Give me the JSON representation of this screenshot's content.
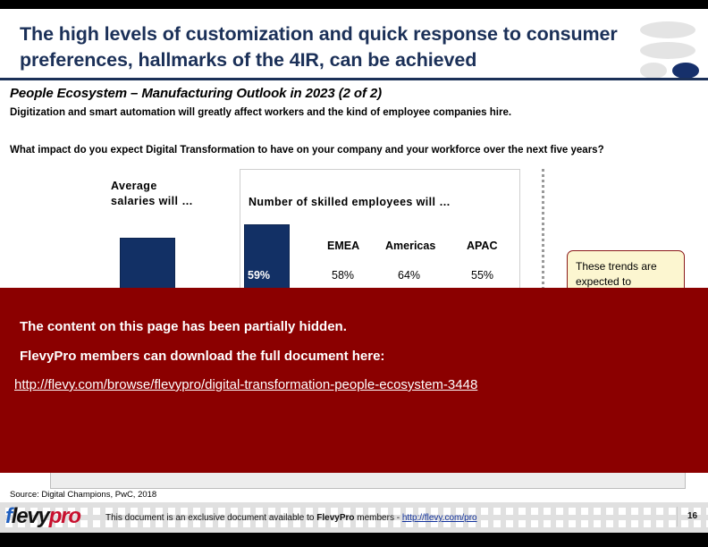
{
  "header": {
    "title": "The high levels of customization and quick response to consumer preferences, hallmarks of the 4IR, can be achieved",
    "accent_color": "#1b3058",
    "decor_dot_color": "#16306b"
  },
  "section": {
    "title": "People Ecosystem – Manufacturing Outlook in 2023 (2 of 2)",
    "description": "Digitization and smart automation will greatly affect workers and the kind of employee companies hire.",
    "question": "What impact do you expect Digital Transformation to have on your company and your workforce over the next five years?"
  },
  "chart_data": {
    "type": "bar",
    "title": "What impact do you expect Digital Transformation to have on your company and your workforce over the next five years?",
    "groups": [
      {
        "label": "Average salaries will …",
        "value": null,
        "value_label": ""
      },
      {
        "label": "Number of skilled employees will …",
        "value": 59,
        "value_label": "59%"
      }
    ],
    "categories": [
      "EMEA",
      "Americas",
      "APAC"
    ],
    "series": [
      {
        "name": "Number of skilled employees will …",
        "values": [
          58,
          64,
          55
        ],
        "value_labels": [
          "58%",
          "64%",
          "55%"
        ]
      }
    ],
    "grid": false,
    "legend": "none",
    "bar_color": "#123065",
    "note": "Lower portions of chart are obscured by an overlay banner"
  },
  "group_one": {
    "label_line1": "Average",
    "label_line2": "salaries will …"
  },
  "panel": {
    "label": "Number of skilled employees will …",
    "bar_value": "59%",
    "columns": [
      "EMEA",
      "Americas",
      "APAC"
    ],
    "values": [
      "58%",
      "64%",
      "55%"
    ]
  },
  "callout": {
    "text": "These trends are expected to",
    "fill_color": "#fcf6d0",
    "border_color": "#8B1A1A"
  },
  "overlay": {
    "line1": "The content on this page has been partially hidden.",
    "line2": "FlevyPro members can download the full document here:",
    "link": "http://flevy.com/browse/flevypro/digital-transformation-people-ecosystem-3448",
    "background_color": "#8B0000"
  },
  "footer": {
    "source": "Source: Digital Champions, PwC, 2018",
    "logo_f": "f",
    "logo_levy": "levy",
    "logo_pro": "pro",
    "text_before": "This document is an exclusive document available to ",
    "brand": "FlevyPro",
    "text_middle": " members - ",
    "link": "http://flevy.com/pro",
    "page_number": "16"
  }
}
